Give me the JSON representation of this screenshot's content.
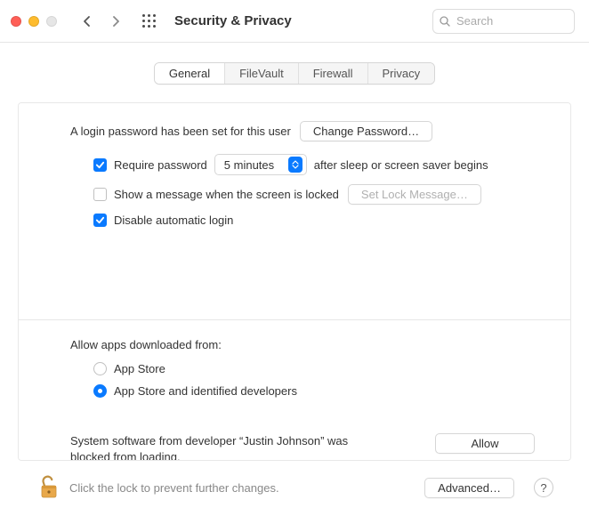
{
  "window": {
    "title": "Security & Privacy",
    "search_placeholder": "Search"
  },
  "tabs": {
    "general": "General",
    "filevault": "FileVault",
    "firewall": "Firewall",
    "privacy": "Privacy",
    "active": "general"
  },
  "general": {
    "password_set_text": "A login password has been set for this user",
    "change_password_label": "Change Password…",
    "require_password_checked": true,
    "require_password_label": "Require password",
    "delay_value": "5 minutes",
    "delay_suffix": "after sleep or screen saver begins",
    "show_message_checked": false,
    "show_message_label": "Show a message when the screen is locked",
    "set_lock_message_label": "Set Lock Message…",
    "disable_auto_login_checked": true,
    "disable_auto_login_label": "Disable automatic login"
  },
  "gatekeeper": {
    "section_label": "Allow apps downloaded from:",
    "option_appstore": "App Store",
    "option_identified": "App Store and identified developers",
    "selected": "identified",
    "blocked_text": "System software from developer “Justin Johnson” was blocked from loading.",
    "allow_label": "Allow"
  },
  "footer": {
    "lock_text": "Click the lock to prevent further changes.",
    "advanced_label": "Advanced…",
    "help_label": "?"
  }
}
